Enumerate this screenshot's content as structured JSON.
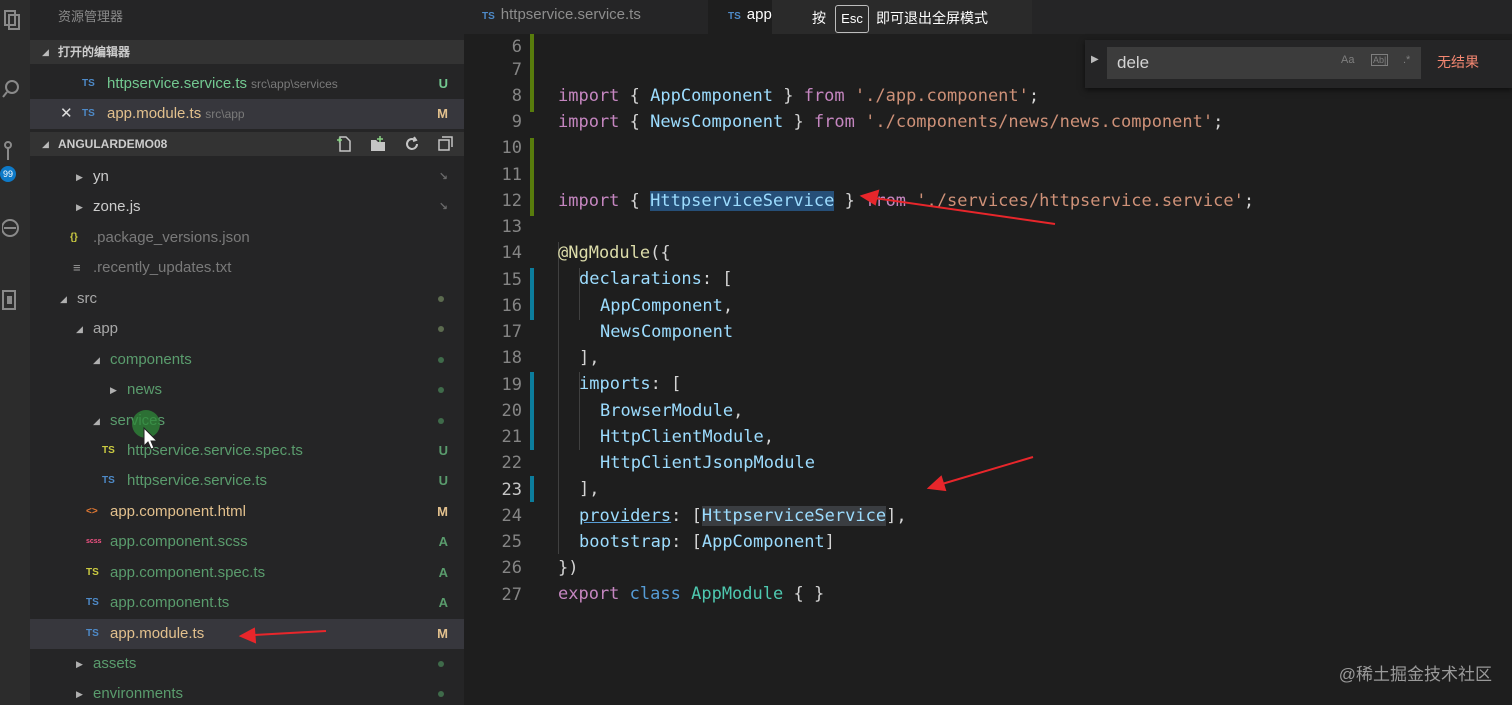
{
  "explorer": {
    "title": "资源管理器",
    "open_editors_title": "打开的编辑器",
    "open_editors": [
      {
        "name": "httpservice.service.ts",
        "path": "src\\app\\services",
        "status": "U",
        "icon": "TS"
      },
      {
        "name": "app.module.ts",
        "path": "src\\app",
        "status": "M",
        "icon": "TS"
      }
    ],
    "project_title": "ANGULARDEMO08",
    "tree": [
      {
        "name": "yn",
        "kind": "folder"
      },
      {
        "name": "zone.js",
        "kind": "folder"
      },
      {
        "name": ".package_versions.json",
        "icon": "{}"
      },
      {
        "name": ".recently_updates.txt",
        "icon": "≡"
      },
      {
        "name": "src",
        "kind": "folder"
      },
      {
        "name": "app",
        "kind": "folder"
      },
      {
        "name": "components",
        "kind": "folder"
      },
      {
        "name": "news",
        "kind": "folder"
      },
      {
        "name": "services",
        "kind": "folder"
      },
      {
        "name": "httpservice.service.spec.ts",
        "icon": "TS",
        "status": "U"
      },
      {
        "name": "httpservice.service.ts",
        "icon": "TS",
        "status": "U"
      },
      {
        "name": "app.component.html",
        "icon": "<>",
        "status": "M"
      },
      {
        "name": "app.component.scss",
        "icon": "scss",
        "status": "A"
      },
      {
        "name": "app.component.spec.ts",
        "icon": "TS",
        "status": "A"
      },
      {
        "name": "app.component.ts",
        "icon": "TS",
        "status": "A"
      },
      {
        "name": "app.module.ts",
        "icon": "TS",
        "status": "M"
      },
      {
        "name": "assets",
        "kind": "folder"
      },
      {
        "name": "environments",
        "kind": "folder"
      }
    ],
    "badge": "99"
  },
  "tabs": [
    {
      "label": "httpservice.service.ts",
      "icon": "TS"
    },
    {
      "label": "app.mo",
      "icon": "TS"
    }
  ],
  "fullscreen_notice": {
    "pre": "按",
    "key": "Esc",
    "post": "即可退出全屏模式"
  },
  "find": {
    "value": "dele",
    "opt_case": "Aa",
    "opt_word": "Ab|",
    "opt_regex": ".*",
    "result": "无结果"
  },
  "editor": {
    "line_numbers": [
      "6",
      "7",
      "8",
      "9",
      "10",
      "11",
      "12",
      "13",
      "14",
      "15",
      "16",
      "17",
      "18",
      "19",
      "20",
      "21",
      "22",
      "23",
      "24",
      "25",
      "26",
      "27"
    ],
    "code": {
      "l7": [
        "import",
        " { ",
        "AppComponent",
        " } ",
        "from",
        " ",
        "'./app.component'",
        ";"
      ],
      "l8": [
        "import",
        " { ",
        "NewsComponent",
        " } ",
        "from",
        " ",
        "'./components/news/news.component'",
        ";"
      ],
      "l11": [
        "import",
        " { ",
        "HttpserviceService",
        " } ",
        "from",
        " ",
        "'./services/httpservice.service'",
        ";"
      ],
      "l13": [
        "@NgModule",
        "({"
      ],
      "l14": [
        "declarations",
        ": ["
      ],
      "l15": [
        "AppComponent",
        ","
      ],
      "l16": [
        "NewsComponent"
      ],
      "l17": [
        "],"
      ],
      "l18": [
        "imports",
        ": ["
      ],
      "l19": [
        "BrowserModule",
        ","
      ],
      "l20": [
        "HttpClientModule",
        ","
      ],
      "l21": [
        "HttpClientJsonpModule"
      ],
      "l22": [
        "],"
      ],
      "l23": [
        "providers",
        ": [",
        "HttpserviceService",
        "],"
      ],
      "l24": [
        "bootstrap",
        ": [",
        "AppComponent",
        "]"
      ],
      "l25": [
        "})"
      ],
      "l26": [
        "export",
        " ",
        "class",
        " ",
        "AppModule",
        " { }"
      ]
    }
  },
  "watermark": "@稀土掘金技术社区",
  "colors": {
    "annotation_arrow": "#e8262b",
    "accent": "#0e7ac8"
  }
}
